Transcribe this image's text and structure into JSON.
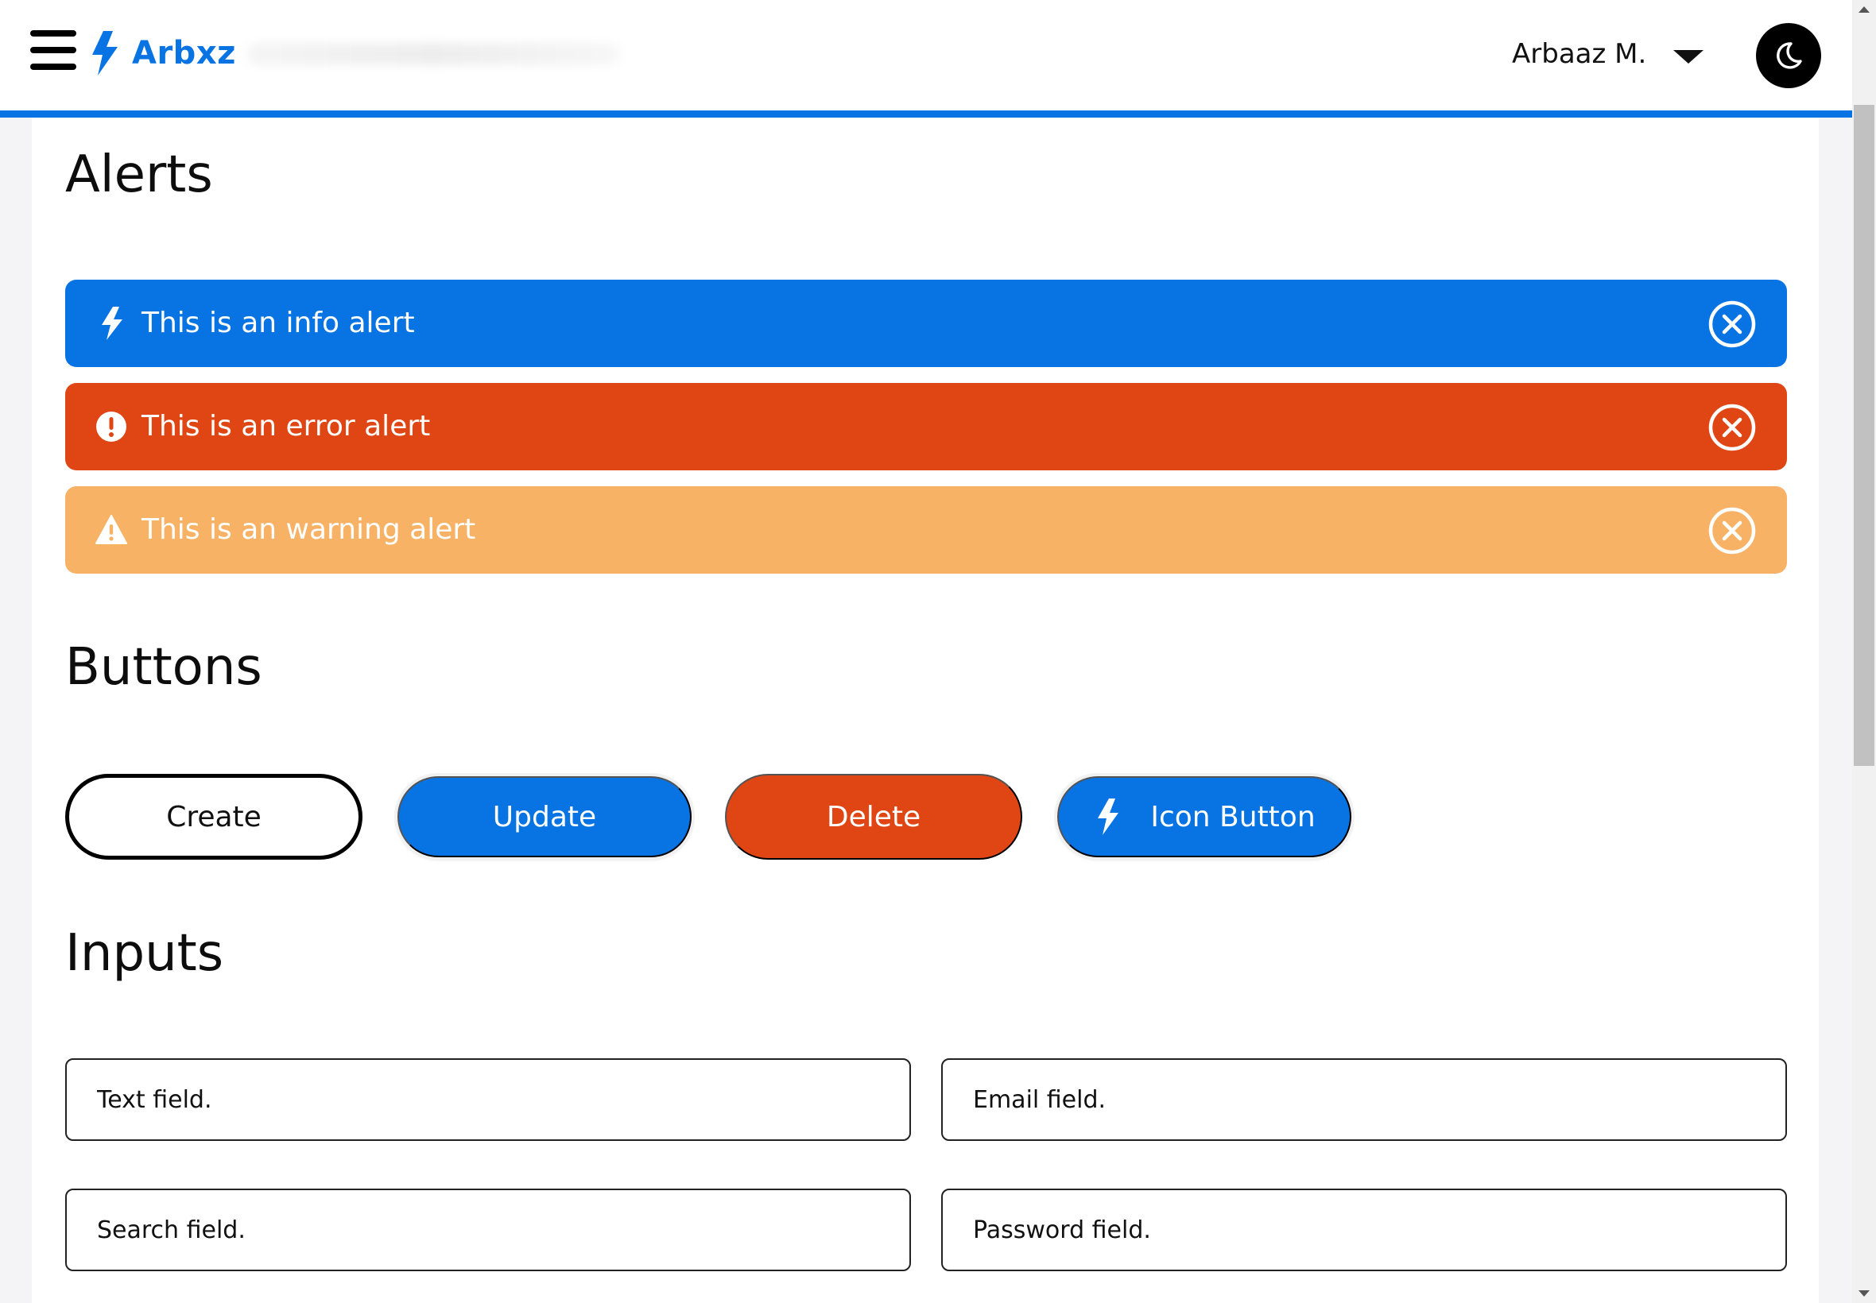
{
  "brand": {
    "name": "Arbxz",
    "icon": "lightning-bolt-icon",
    "color": "#0873e3"
  },
  "header": {
    "menu_icon": "hamburger-icon",
    "user_name": "Arbaaz M.",
    "user_menu_icon": "caret-down-icon",
    "theme_icon": "moon-icon"
  },
  "sections": {
    "alerts_title": "Alerts",
    "buttons_title": "Buttons",
    "inputs_title": "Inputs"
  },
  "alerts": [
    {
      "type": "info",
      "text": "This is an info alert",
      "icon": "lightning-bolt-icon",
      "color": "#0873e3"
    },
    {
      "type": "error",
      "text": "This is an error alert",
      "icon": "exclamation-circle-icon",
      "color": "#e04614"
    },
    {
      "type": "warning",
      "text": "This is an warning alert",
      "icon": "warning-triangle-icon",
      "color": "#f7b266"
    }
  ],
  "alert_close_icon": "close-circle-icon",
  "buttons": {
    "create": "Create",
    "update": "Update",
    "delete": "Delete",
    "icon_button": "Icon Button",
    "icon_button_icon": "lightning-bolt-icon"
  },
  "inputs": {
    "text_placeholder": "Text field.",
    "email_placeholder": "Email field.",
    "search_placeholder": "Search field.",
    "password_placeholder": "Password field."
  },
  "colors": {
    "primary": "#0873e3",
    "danger": "#e04614",
    "warning": "#f7b266",
    "background": "#f4f4f6"
  }
}
